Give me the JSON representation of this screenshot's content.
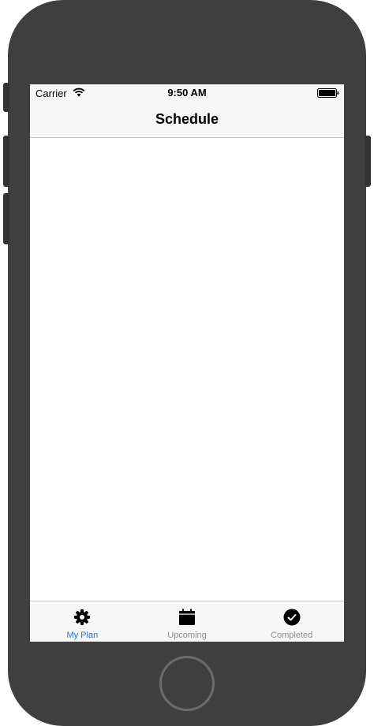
{
  "status_bar": {
    "carrier": "Carrier",
    "time": "9:50 AM"
  },
  "nav_bar": {
    "title": "Schedule"
  },
  "tab_bar": {
    "items": [
      {
        "label": "My Plan",
        "icon": "gear-icon",
        "active": true
      },
      {
        "label": "Upcoming",
        "icon": "calendar-icon",
        "active": false
      },
      {
        "label": "Completed",
        "icon": "checkmark-circle-icon",
        "active": false
      }
    ]
  },
  "colors": {
    "device_frame": "#3f3f3f",
    "bar_background": "#f7f7f7",
    "active_tab": "#2f6fd1",
    "inactive_tab": "#8e8e93"
  }
}
